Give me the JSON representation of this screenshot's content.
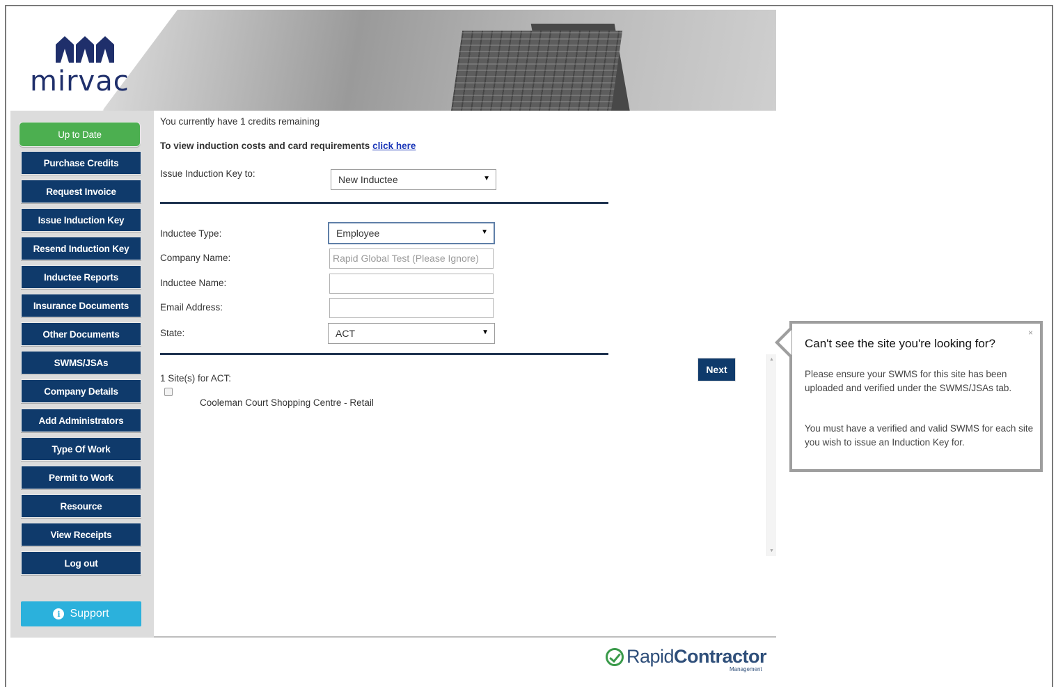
{
  "brand": {
    "logo_text": "mirvac",
    "logo_color": "#1f2f6b"
  },
  "sidebar": {
    "items": [
      {
        "label": "Up to Date",
        "style": "green"
      },
      {
        "label": "Purchase Credits"
      },
      {
        "label": "Request Invoice"
      },
      {
        "label": "Issue Induction Key"
      },
      {
        "label": "Resend Induction Key"
      },
      {
        "label": "Inductee Reports"
      },
      {
        "label": "Insurance Documents"
      },
      {
        "label": "Other Documents"
      },
      {
        "label": "SWMS/JSAs"
      },
      {
        "label": "Company Details"
      },
      {
        "label": "Add Administrators"
      },
      {
        "label": "Type Of Work"
      },
      {
        "label": "Permit to Work"
      },
      {
        "label": "Resource"
      },
      {
        "label": "View Receipts"
      },
      {
        "label": "Log out"
      }
    ],
    "support_label": "Support"
  },
  "main": {
    "credits_text": "You currently have 1 credits remaining",
    "costs_text": "To view induction costs and card requirements",
    "costs_link": "click here",
    "issue_key_label": "Issue Induction Key to:",
    "issue_key_value": "New Inductee",
    "inductee_type_label": "Inductee Type:",
    "inductee_type_value": "Employee",
    "company_name_label": "Company Name:",
    "company_name_value": "Rapid Global Test (Please Ignore)",
    "inductee_name_label": "Inductee Name:",
    "inductee_name_value": "",
    "email_label": "Email Address:",
    "email_value": "",
    "state_label": "State:",
    "state_value": "ACT",
    "sites_heading": "1 Site(s) for ACT:",
    "sites": [
      {
        "name": "Cooleman Court Shopping Centre - Retail",
        "checked": false
      }
    ],
    "next_label": "Next"
  },
  "popover": {
    "title": "Can't see the site you're looking for?",
    "body1": "Please ensure your SWMS for this site has been uploaded and verified under the SWMS/JSAs tab.",
    "body2": "You must have a verified and valid SWMS for each site you wish to issue an Induction Key for.",
    "close": "×"
  },
  "footer": {
    "brand_left": "Rapid",
    "brand_right": "Contractor",
    "brand_sub": "Management"
  },
  "colors": {
    "nav_bg": "#0f3a6b",
    "green": "#4caf50",
    "support": "#2bb1dc"
  }
}
